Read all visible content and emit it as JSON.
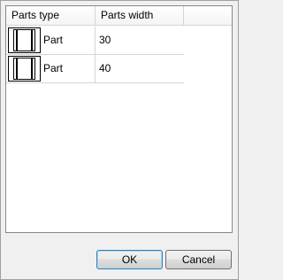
{
  "table": {
    "columns": [
      "Parts type",
      "Parts width"
    ],
    "rows": [
      {
        "type_label": "Part",
        "width": "30",
        "icon": "part-icon"
      },
      {
        "type_label": "Part",
        "width": "40",
        "icon": "part-icon"
      }
    ]
  },
  "buttons": {
    "ok_label": "OK",
    "cancel_label": "Cancel"
  },
  "colors": {
    "background": "#f0f0f0",
    "list_background": "#ffffff",
    "grid_line": "#d5d5d5",
    "default_button_border": "#3c7fb1"
  }
}
